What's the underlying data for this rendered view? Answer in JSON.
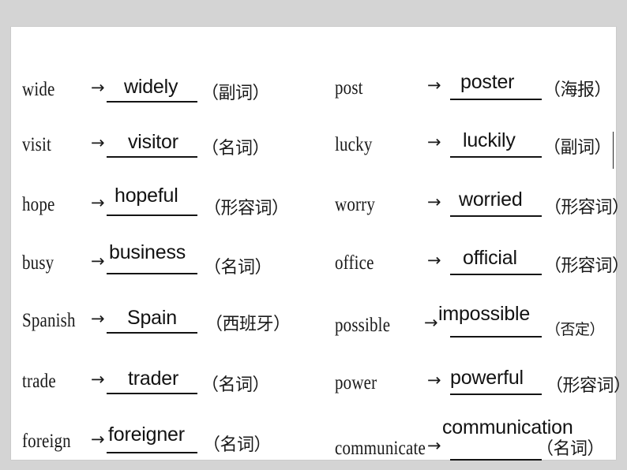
{
  "slide": {
    "background_color": "#ffffff",
    "page_background_color": "#d4d4d4",
    "arrow_glyph": "→",
    "caret_visible": true
  },
  "left_column": [
    {
      "source": "wide",
      "answer": "widely",
      "annotation": "（副词）"
    },
    {
      "source": "visit",
      "answer": "visitor",
      "annotation": "（名词）"
    },
    {
      "source": "hope",
      "answer": "hopeful",
      "annotation": "（形容词）"
    },
    {
      "source": "busy",
      "answer": "business",
      "annotation": "（名词）"
    },
    {
      "source": "Spanish",
      "answer": "Spain",
      "annotation": "（西班牙）"
    },
    {
      "source": "trade",
      "answer": "trader",
      "annotation": "（名词）"
    },
    {
      "source": "foreign",
      "answer": "foreigner",
      "annotation": "（名词）"
    }
  ],
  "right_column": [
    {
      "source": "post",
      "answer": "poster",
      "annotation": "（海报）"
    },
    {
      "source": "lucky",
      "answer": "luckily",
      "annotation": "（副词）"
    },
    {
      "source": "worry",
      "answer": "worried",
      "annotation": "（形容词）"
    },
    {
      "source": "office",
      "answer": "official",
      "annotation": "（形容词）"
    },
    {
      "source": "possible",
      "answer": "impossible",
      "annotation": "（否定）"
    },
    {
      "source": "power",
      "answer": "powerful",
      "annotation": "（形容词）"
    },
    {
      "source": "communicate",
      "answer": "communication",
      "annotation": "（名词）"
    }
  ]
}
